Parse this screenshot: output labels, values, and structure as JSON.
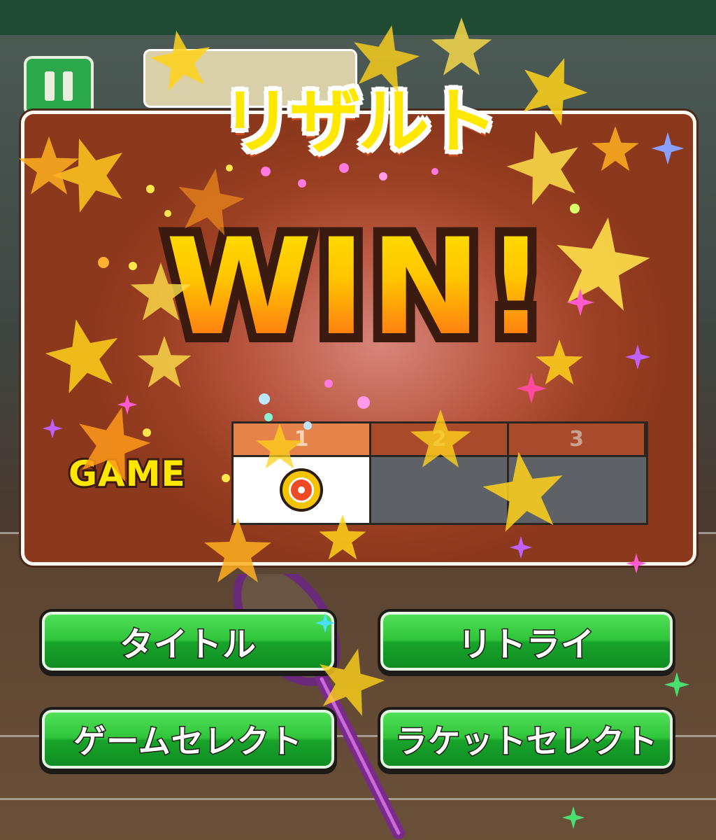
{
  "header": {
    "result_title": "リザルト"
  },
  "result": {
    "outcome": "WIN!"
  },
  "games": {
    "label": "GAME",
    "columns": [
      "1",
      "2",
      "3"
    ],
    "results": [
      "win",
      "",
      ""
    ]
  },
  "buttons": {
    "title": "タイトル",
    "retry": "リトライ",
    "game_select": "ゲームセレクト",
    "racket_select": "ラケットセレクト"
  },
  "colors": {
    "button_green": "#2fc43a",
    "panel_brown": "#9b3f22",
    "title_yellow": "#ffe800",
    "win_orange": "#ff8a10"
  }
}
